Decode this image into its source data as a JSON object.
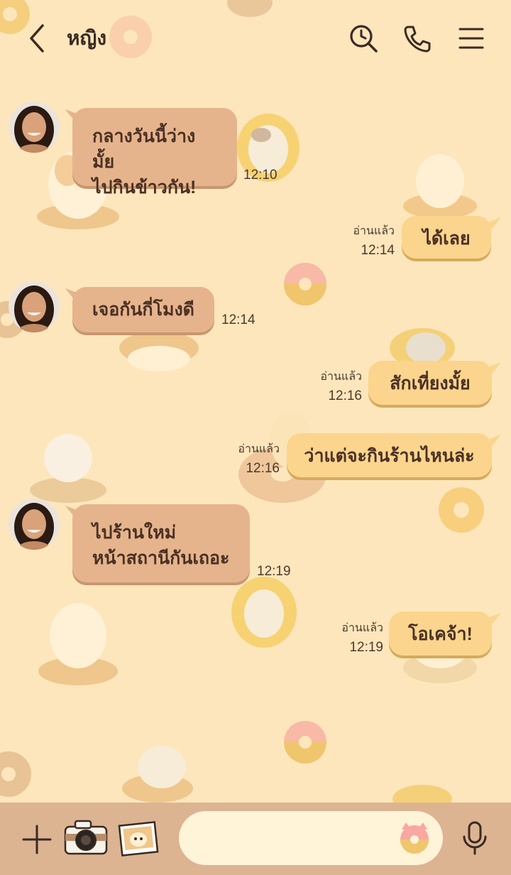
{
  "header": {
    "contact_name": "หญิง"
  },
  "messages": [
    {
      "direction": "in",
      "lines": [
        "กลางวันนี้ว่างมั้ย",
        "ไปกินข้าวกัน!"
      ],
      "time": "12:10"
    },
    {
      "direction": "out",
      "text": "ได้เลย",
      "read_label": "อ่านแล้ว",
      "time": "12:14"
    },
    {
      "direction": "in",
      "lines": [
        "เจอกันกี่โมงดี"
      ],
      "time": "12:14"
    },
    {
      "direction": "out",
      "text": "สักเที่ยงมั้ย",
      "read_label": "อ่านแล้ว",
      "time": "12:16"
    },
    {
      "direction": "out",
      "text": "ว่าแต่จะกินร้านไหนล่ะ",
      "read_label": "อ่านแล้ว",
      "time": "12:16"
    },
    {
      "direction": "in",
      "lines": [
        "ไปร้านใหม่",
        "หน้าสถานีกันเถอะ"
      ],
      "time": "12:19"
    },
    {
      "direction": "out",
      "text": "โอเคจ้า!",
      "read_label": "อ่านแล้ว",
      "time": "12:19"
    }
  ],
  "input": {
    "value": "",
    "placeholder": ""
  },
  "icons": {
    "header": [
      "back-chevron-icon",
      "search-history-icon",
      "phone-icon",
      "menu-icon"
    ],
    "bottom": [
      "plus-icon",
      "camera-icon",
      "photo-icon",
      "sticker-icon",
      "microphone-icon"
    ]
  },
  "colors": {
    "background": "#fde6bb",
    "incoming_bubble": "#e6b48c",
    "outgoing_bubble": "#fbd58d",
    "bottom_bar": "#dcb492",
    "text": "#4a3024"
  }
}
